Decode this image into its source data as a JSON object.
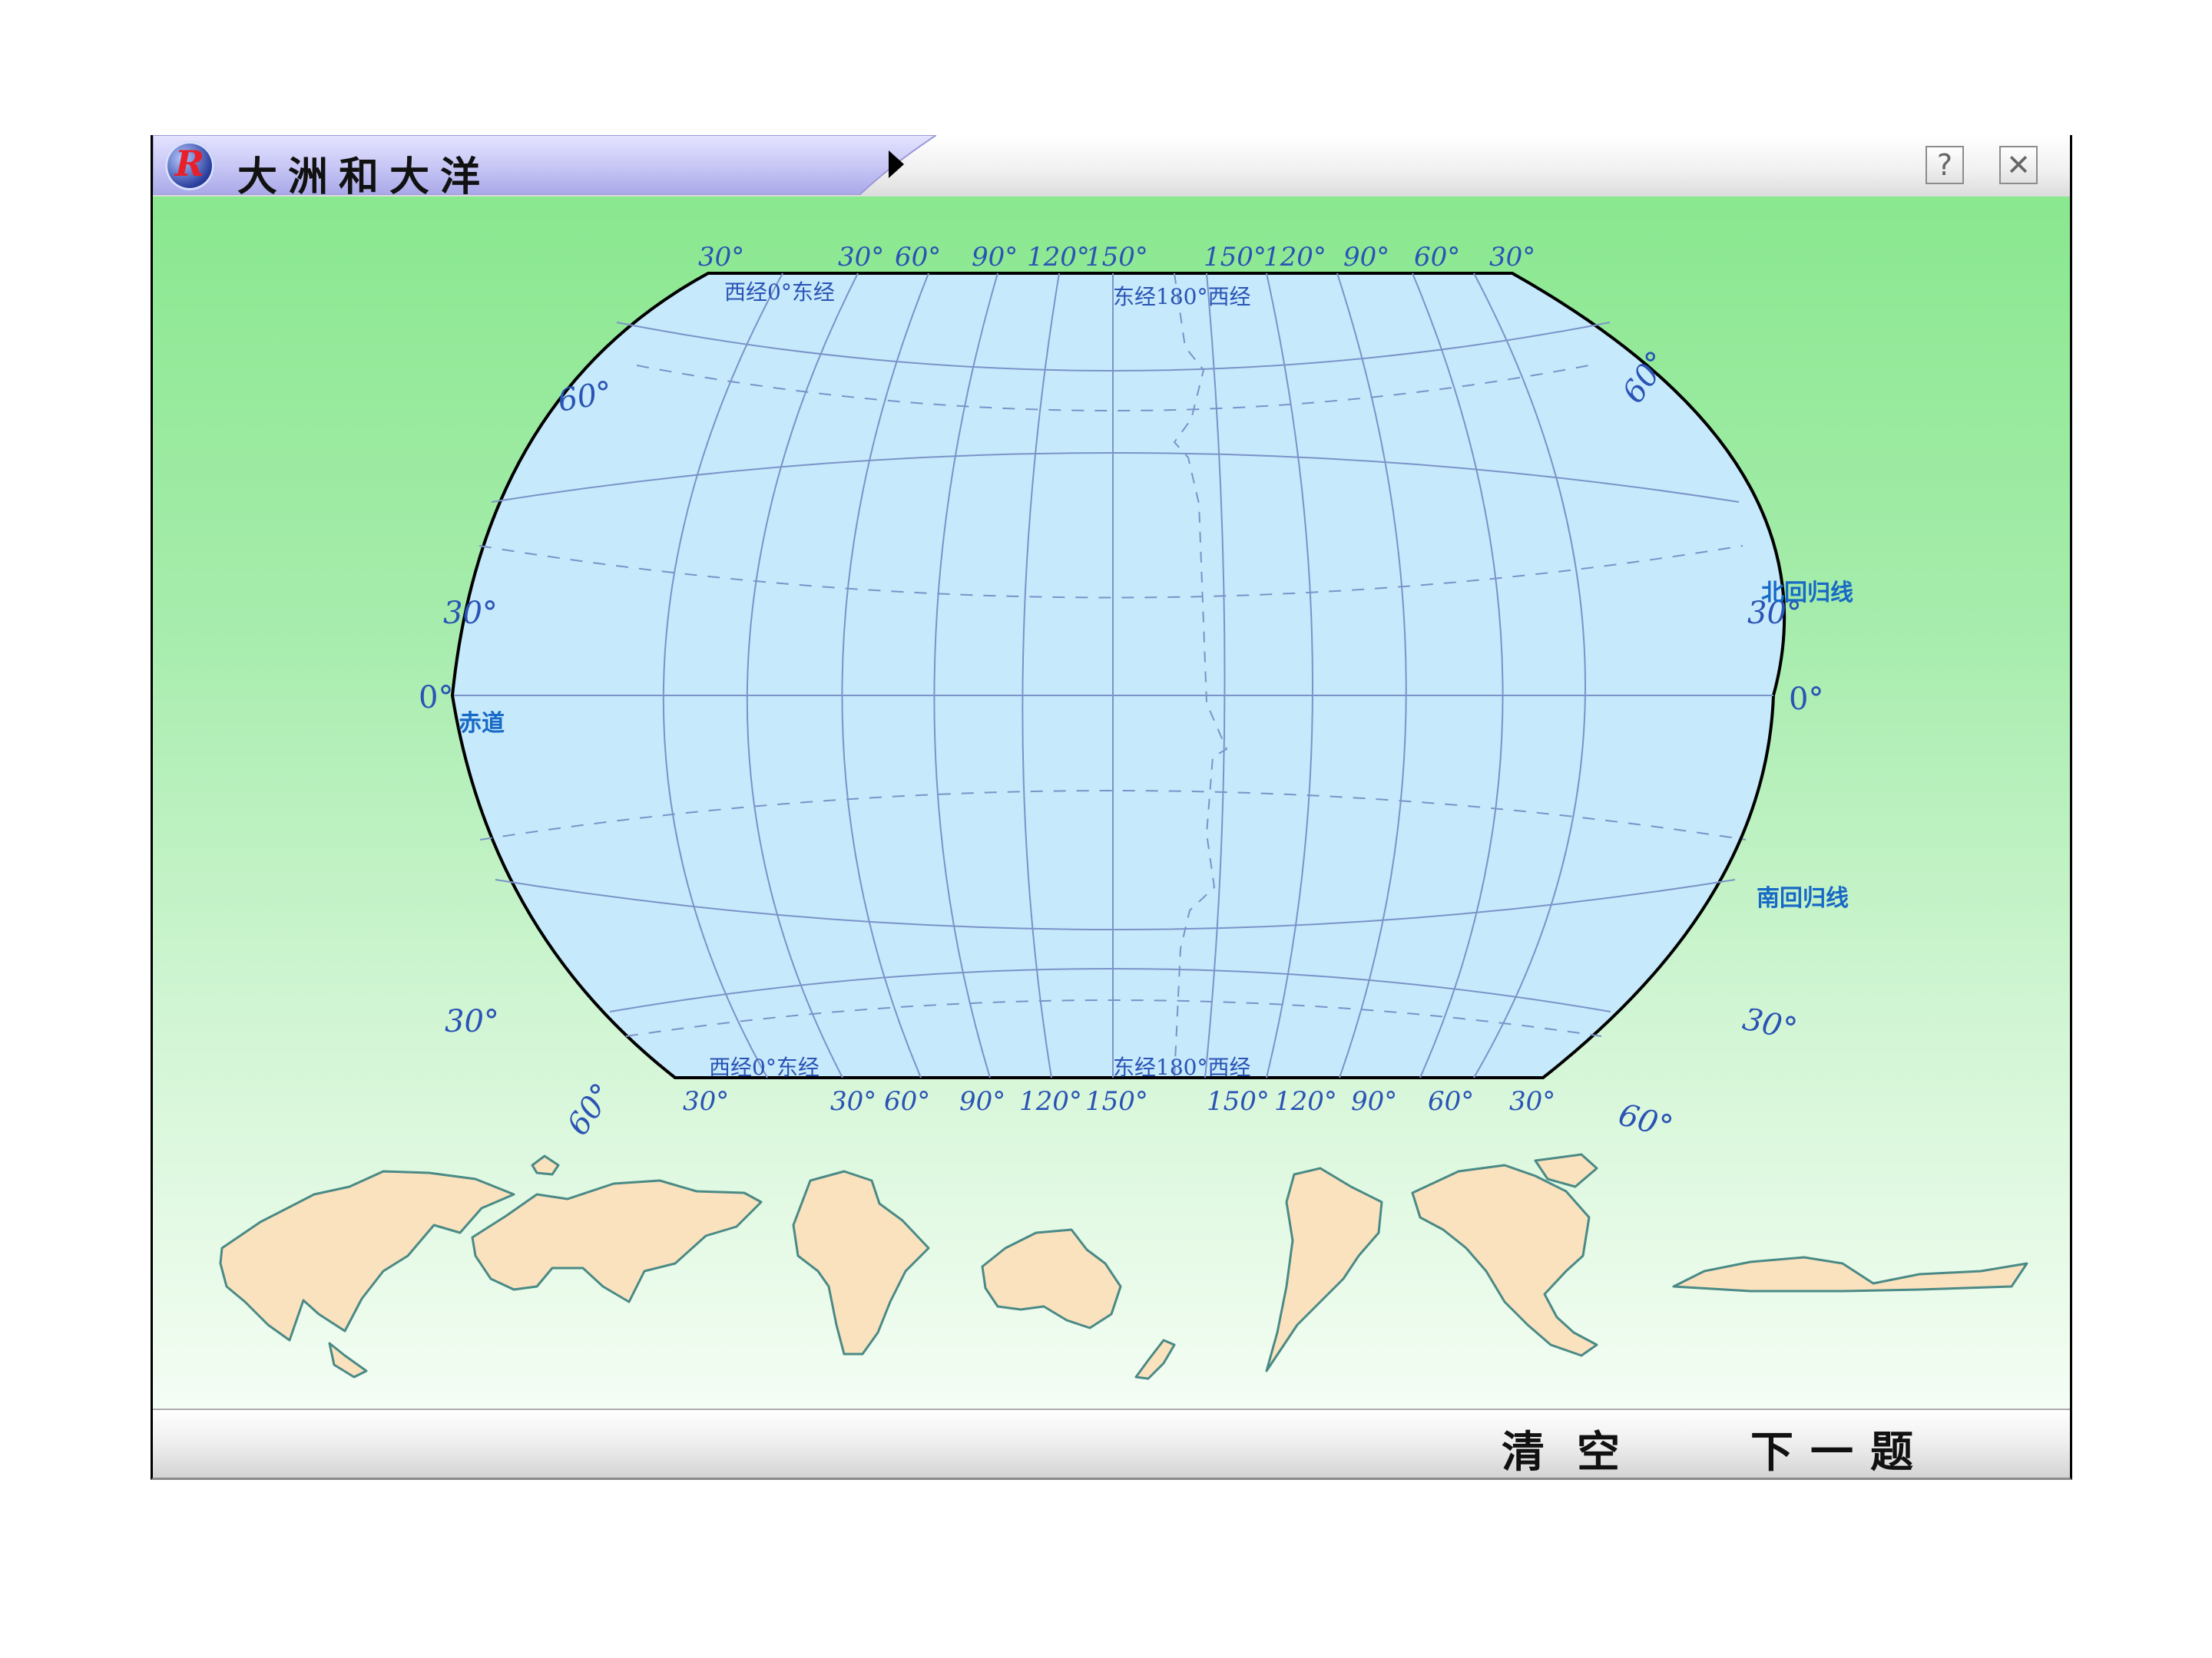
{
  "app": {
    "title": "大洲和大洋",
    "logo_letter": "R",
    "help_label": "?",
    "close_label": "✕"
  },
  "map": {
    "top_longitudes_left": [
      "30°",
      "30°",
      "60°",
      "90°",
      "120°",
      "150°"
    ],
    "top_longitudes_right": [
      "150°",
      "120°",
      "90°",
      "60°",
      "30°"
    ],
    "bottom_longitudes_left": [
      "30°",
      "30°",
      "60°",
      "90°",
      "120°",
      "150°"
    ],
    "bottom_longitudes_right": [
      "150°",
      "120°",
      "90°",
      "60°",
      "30°"
    ],
    "left_latitudes": [
      "60°",
      "30°",
      "0°",
      "30°",
      "60°"
    ],
    "right_latitudes": [
      "60°",
      "30°",
      "0°",
      "30°",
      "60°"
    ],
    "prime_meridian_label": "西经0°东经",
    "antimeridian_label": "东经180°西经",
    "prime_meridian_label_bottom": "西经0°东经",
    "antimeridian_label_bottom": "东经180°西经",
    "equator_label": "赤道",
    "tropic_cancer_label": "北回归线",
    "tropic_capricorn_label": "南回归线"
  },
  "continents": [
    "asia",
    "europe",
    "africa",
    "oceania",
    "south-america",
    "north-america",
    "antarctica"
  ],
  "colors": {
    "ocean": "#c6e9fb",
    "grid": "#7b93c9",
    "land": "#fbe2be",
    "coast": "#4a8a86",
    "label_blue": "#2a53b5",
    "special_label": "#1769c6"
  },
  "buttons": {
    "clear": "清空",
    "next": "下一题"
  }
}
